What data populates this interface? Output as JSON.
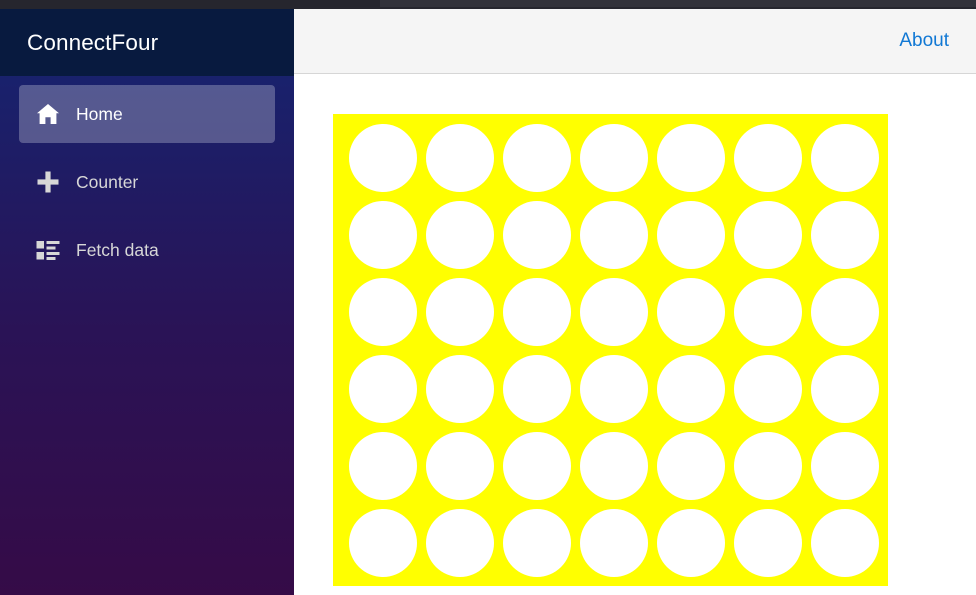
{
  "browser": {
    "chrome_bar": "#26262e"
  },
  "sidebar": {
    "brand": "ConnectFour",
    "brand_bg": "#081a3f",
    "gradient_from": "#1b2e6e",
    "gradient_to": "#350b47",
    "items": [
      {
        "label": "Home",
        "icon": "home-icon",
        "active": true
      },
      {
        "label": "Counter",
        "icon": "plus-icon",
        "active": false
      },
      {
        "label": "Fetch data",
        "icon": "list-alt-icon",
        "active": false
      }
    ]
  },
  "topbar": {
    "about_label": "About",
    "about_color": "#1178d4",
    "background": "#f5f5f5"
  },
  "board": {
    "columns": 7,
    "rows": 6,
    "board_color": "#ffff00",
    "empty_color": "#ffffff",
    "player_one_color": "#ff0000",
    "player_two_color": "#ffd700",
    "cells": [
      [
        "empty",
        "empty",
        "empty",
        "empty",
        "empty",
        "empty",
        "empty"
      ],
      [
        "empty",
        "empty",
        "empty",
        "empty",
        "empty",
        "empty",
        "empty"
      ],
      [
        "empty",
        "empty",
        "empty",
        "empty",
        "empty",
        "empty",
        "empty"
      ],
      [
        "empty",
        "empty",
        "empty",
        "empty",
        "empty",
        "empty",
        "empty"
      ],
      [
        "empty",
        "empty",
        "empty",
        "empty",
        "empty",
        "empty",
        "empty"
      ],
      [
        "empty",
        "empty",
        "empty",
        "empty",
        "empty",
        "empty",
        "empty"
      ]
    ]
  }
}
